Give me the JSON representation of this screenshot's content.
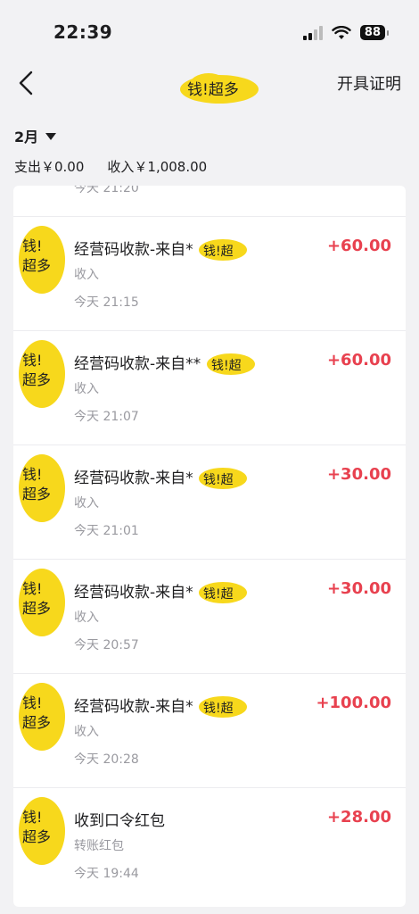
{
  "status_bar": {
    "time": "22:39",
    "battery": "88"
  },
  "nav": {
    "title_redacted_text": "钱!超多",
    "cert_label": "开具证明"
  },
  "summary": {
    "month": "2月",
    "expense": "支出￥0.00",
    "income": "收入￥1,008.00"
  },
  "partial_row_time": "今天 21:20",
  "transactions": [
    {
      "title": "经营码收款-来自*",
      "type": "收入",
      "time": "今天 21:15",
      "amount": "+60.00"
    },
    {
      "title": "经营码收款-来自**",
      "type": "收入",
      "time": "今天 21:07",
      "amount": "+60.00"
    },
    {
      "title": "经营码收款-来自*",
      "type": "收入",
      "time": "今天 21:01",
      "amount": "+30.00"
    },
    {
      "title": "经营码收款-来自*",
      "type": "收入",
      "time": "今天 20:57",
      "amount": "+30.00"
    },
    {
      "title": "经营码收款-来自*",
      "type": "收入",
      "time": "今天 20:28",
      "amount": "+100.00"
    },
    {
      "title": "收到口令红包",
      "type": "转账红包",
      "time": "今天 19:44",
      "amount": "+28.00"
    }
  ],
  "colors": {
    "income_amount": "#e8414f",
    "redaction": "#f7d81c"
  }
}
